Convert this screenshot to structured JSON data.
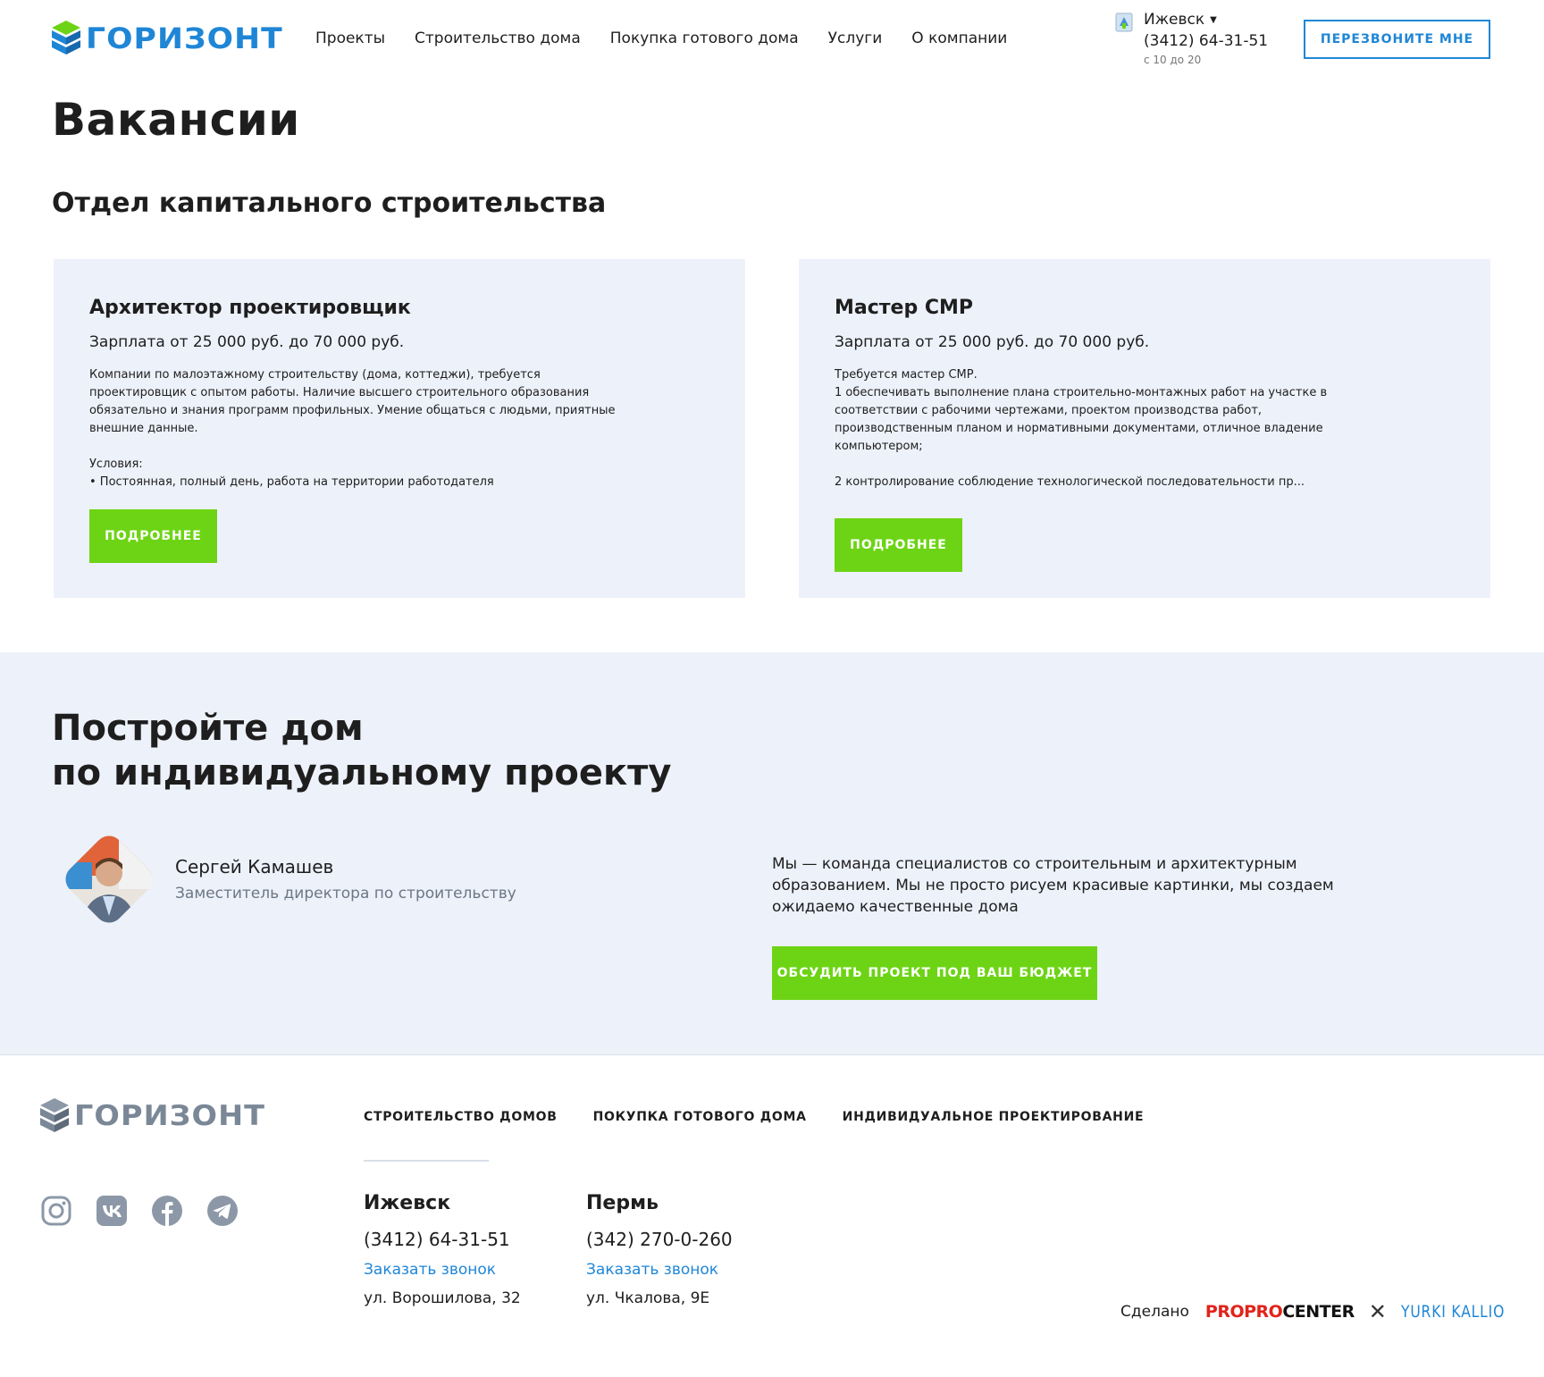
{
  "header": {
    "logo_text": "ГОРИЗОНТ",
    "nav": [
      "Проекты",
      "Строительство дома",
      "Покупка готового дома",
      "Услуги",
      "О компании"
    ],
    "city": "Ижевск",
    "phone": "(3412) 64-31-51",
    "hours": "с 10 до 20",
    "callback_label": "ПЕРЕЗВОНИТЕ МНЕ"
  },
  "page_title": "Вакансии",
  "section_title": "Отдел капитального строительства",
  "vacancies": [
    {
      "title": "Архитектор проектировщик",
      "salary": "Зарплата от 25 000 руб. до 70 000 руб.",
      "description": "Компании по малоэтажному строительству (дома, коттеджи), требуется\nпроектировщик с опытом работы. Наличие высшего строительного образования\nобязательно и знания программ профильных. Умение общаться с людьми, приятные\nвнешние данные.\n\nУсловия:\n• Постоянная, полный день, работа на территории работодателя",
      "button": "ПОДРОБНЕЕ"
    },
    {
      "title": "Мастер СМР",
      "salary": "Зарплата от 25 000 руб. до 70 000 руб.",
      "description": "Требуется мастер СМР.\n1 обеспечивать выполнение плана строительно-монтажных работ на участке в\nсоответствии с рабочими чертежами, проектом производства работ,\nпроизводственным планом и нормативными документами, отличное владение\nкомпьютером;\n\n2 контролирование соблюдение технологической последовательности пр...",
      "button": "ПОДРОБНЕЕ"
    }
  ],
  "cta": {
    "title_line1": "Постройте дом",
    "title_line2": "по индивидуальному проекту",
    "person_name": "Сергей Камашев",
    "person_role": "Заместитель директора по строительству",
    "text": "Мы — команда специалистов со строительным и архитектурным образованием. Мы не просто рисуем красивые картинки, мы создаем ожидаемо качественные дома",
    "button": "ОБСУДИТЬ ПРОЕКТ ПОД ВАШ БЮДЖЕТ"
  },
  "footer": {
    "logo_text": "ГОРИЗОНТ",
    "nav": [
      "СТРОИТЕЛЬСТВО ДОМОВ",
      "ПОКУПКА ГОТОВОГО ДОМА",
      "ИНДИВИДУАЛЬНОЕ ПРОЕКТИРОВАНИЕ"
    ],
    "socials": [
      "instagram-icon",
      "vk-icon",
      "facebook-icon",
      "telegram-icon"
    ],
    "cities": [
      {
        "name": "Ижевск",
        "phone": "(3412) 64-31-51",
        "link": "Заказать звонок",
        "address": "ул. Ворошилова, 32"
      },
      {
        "name": "Пермь",
        "phone": "(342) 270-0-260",
        "link": "Заказать звонок",
        "address": "ул. Чкалова, 9Е"
      }
    ],
    "made_label": "Сделано",
    "made_ppc_red": "PROPRO",
    "made_ppc_black": "CENTER",
    "made_x": "✕",
    "made_yk": "YURKI KALLIO"
  },
  "colors": {
    "brand_blue": "#1f86d6",
    "accent_green": "#6dd415",
    "card_bg": "#edf1fa"
  }
}
